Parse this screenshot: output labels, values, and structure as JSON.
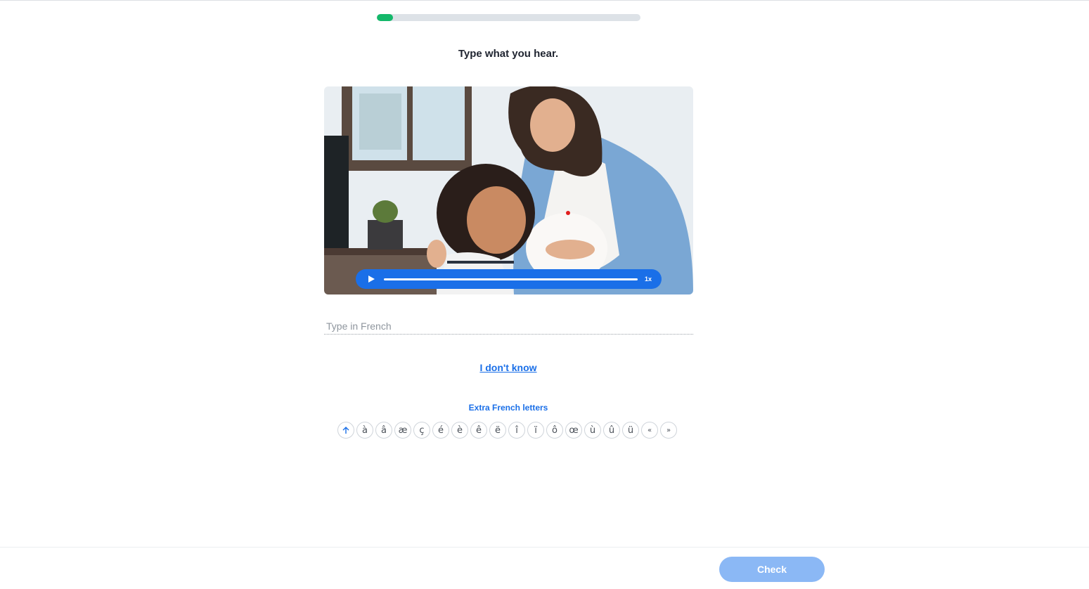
{
  "progress": {
    "fraction": 0.06
  },
  "prompt": "Type what you hear.",
  "media": {
    "image_description_icon": "photo-mother-and-daughter",
    "player": {
      "play_icon": "play-icon",
      "speed": "1x"
    }
  },
  "answer": {
    "placeholder": "Type in French",
    "value": ""
  },
  "dont_know": "I don't know",
  "extra_letters": {
    "title": "Extra French letters",
    "shift_icon": "arrow-up-icon",
    "keys": [
      "à",
      "â",
      "æ",
      "ç",
      "é",
      "è",
      "ê",
      "ë",
      "î",
      "ï",
      "ô",
      "œ",
      "ù",
      "û",
      "ü",
      "«",
      "»"
    ]
  },
  "footer": {
    "check": "Check"
  },
  "colors": {
    "accent": "#1a6fe8",
    "progress": "#14b86a",
    "check_disabled": "#8bb8f5"
  }
}
